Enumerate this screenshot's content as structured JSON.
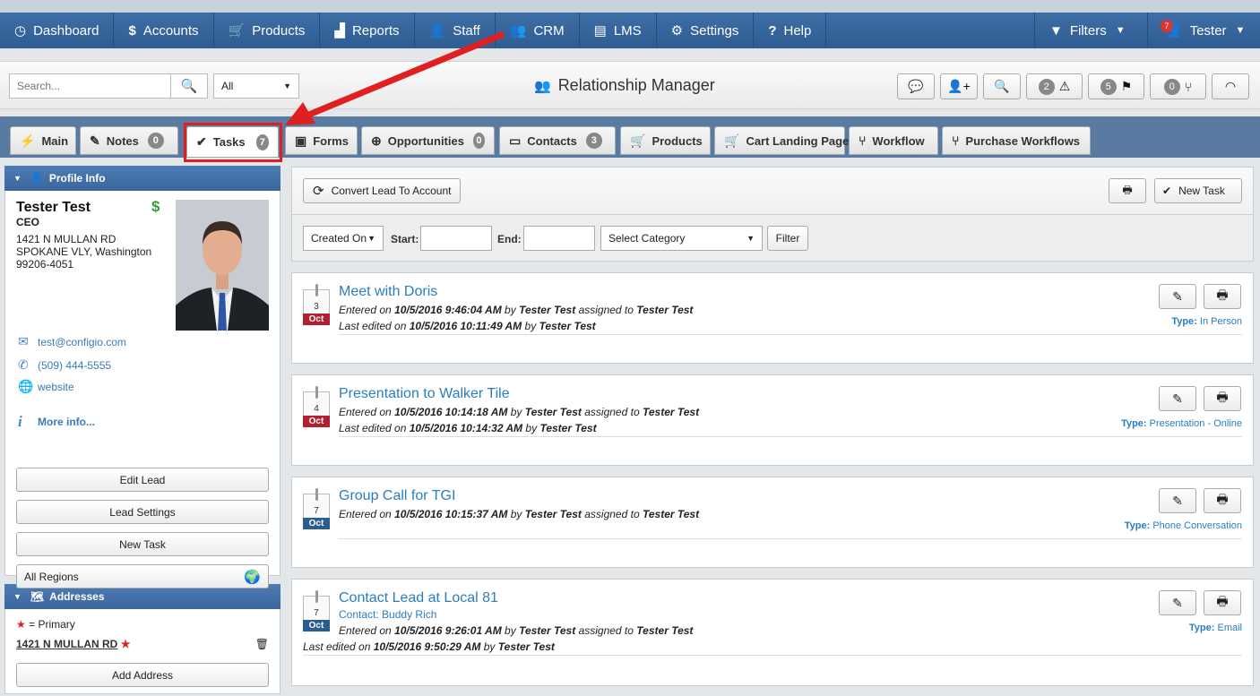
{
  "nav": {
    "items": [
      {
        "label": "Dashboard",
        "icon": "dashboard-icon",
        "glyph": "◷"
      },
      {
        "label": "Accounts",
        "icon": "dollar-icon",
        "glyph": "$"
      },
      {
        "label": "Products",
        "icon": "cart-icon",
        "glyph": "🛒"
      },
      {
        "label": "Reports",
        "icon": "chart-icon",
        "glyph": "📊"
      },
      {
        "label": "Staff",
        "icon": "user-icon",
        "glyph": "👤"
      },
      {
        "label": "CRM",
        "icon": "users-icon",
        "glyph": "👥"
      },
      {
        "label": "LMS",
        "icon": "book-icon",
        "glyph": "📖"
      },
      {
        "label": "Settings",
        "icon": "gear-icon",
        "glyph": "⚙"
      },
      {
        "label": "Help",
        "icon": "question-icon",
        "glyph": "?"
      }
    ],
    "filters_label": "Filters",
    "user_label": "Tester",
    "user_badge": "7"
  },
  "toolbar": {
    "search_placeholder": "Search...",
    "scope_value": "All",
    "title": "Relationship Manager",
    "alerts_count": "2",
    "flags_count": "5",
    "workflow_count": "0"
  },
  "tabs": [
    {
      "label": "Main",
      "icon": "bolt-icon",
      "glyph": "⚡"
    },
    {
      "label": "Notes",
      "icon": "edit-icon",
      "glyph": "✎",
      "count": "0"
    },
    {
      "label": "Tasks",
      "icon": "check-icon",
      "glyph": "✔",
      "count": "7"
    },
    {
      "label": "Forms",
      "icon": "clipboard-icon",
      "glyph": "📋"
    },
    {
      "label": "Opportunities",
      "icon": "crosshair-icon",
      "glyph": "⊕",
      "count": "0"
    },
    {
      "label": "Contacts",
      "icon": "id-card-icon",
      "glyph": "🪪",
      "count": "3"
    },
    {
      "label": "Products",
      "icon": "cart-icon",
      "glyph": "🛒"
    },
    {
      "label": "Cart Landing Page",
      "icon": "cart-page-icon",
      "glyph": "🛒"
    },
    {
      "label": "Workflow",
      "icon": "workflow-icon",
      "glyph": "⑂"
    },
    {
      "label": "Purchase Workflows",
      "icon": "workflow-icon",
      "glyph": "⑂"
    }
  ],
  "profile": {
    "header": "Profile Info",
    "name": "Tester Test",
    "job_title": "CEO",
    "address_line1": "1421 N MULLAN RD",
    "address_line2": "SPOKANE VLY, Washington",
    "address_line3": "99206-4051",
    "dollar": "$",
    "email": "test@configio.com",
    "phone": "(509) 444-5555",
    "website": "website",
    "more_info": "More info...",
    "edit_lead": "Edit Lead",
    "lead_settings": "Lead Settings",
    "new_task": "New Task",
    "regions": "All Regions"
  },
  "addresses": {
    "header": "Addresses",
    "primary_legend": "= Primary",
    "primary_address": "1421 N MULLAN RD",
    "add_address": "Add Address"
  },
  "main": {
    "convert_label": "Convert Lead To Account",
    "new_task_label": "New Task",
    "sort_value": "Created On",
    "start_label": "Start:",
    "end_label": "End:",
    "category_value": "Select Category",
    "filter_label": "Filter"
  },
  "tasks": [
    {
      "title": "Meet with Doris",
      "day": "3",
      "month": "Oct",
      "entered": "10/5/2016 9:46:04 AM",
      "by": "Tester Test",
      "assigned": "Tester Test",
      "edited": "10/5/2016 10:11:49 AM",
      "edited_by": "Tester Test",
      "type": "In Person"
    },
    {
      "title": "Presentation to Walker Tile",
      "day": "4",
      "month": "Oct",
      "entered": "10/5/2016 10:14:18 AM",
      "by": "Tester Test",
      "assigned": "Tester Test",
      "edited": "10/5/2016 10:14:32 AM",
      "edited_by": "Tester Test",
      "type": "Presentation - Online"
    },
    {
      "title": "Group Call for TGI",
      "day": "7",
      "month": "Oct",
      "entered": "10/5/2016 10:15:37 AM",
      "by": "Tester Test",
      "assigned": "Tester Test",
      "type": "Phone Conversation"
    },
    {
      "title": "Contact Lead at Local 81",
      "day": "7",
      "month": "Oct",
      "contact_label": "Contact:",
      "contact_name": "Buddy Rich",
      "entered": "10/5/2016 9:26:01 AM",
      "by": "Tester Test",
      "assigned": "Tester Test",
      "edited": "10/5/2016 9:50:29 AM",
      "edited_by": "Tester Test",
      "type": "Email"
    }
  ],
  "text": {
    "entered_on": "Entered on",
    "by": "by",
    "assigned_to": "assigned to",
    "last_edited_on": "Last edited on",
    "type_label": "Type:"
  },
  "colors": {
    "nav_bg": "#3d6ea5",
    "tab_bar": "#597aa1",
    "link": "#2a7ec0",
    "highlight": "#e02020",
    "month_red": "#b02030",
    "month_blue": "#2a5d8f"
  }
}
